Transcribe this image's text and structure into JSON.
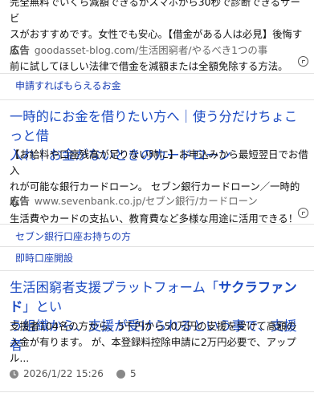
{
  "ad1": {
    "desc_lines": [
      "完全無料でいくら減額できるかスマホから30秒で診断できるサービ",
      "スがおすすめです。女性でも安心。【借金がある人は必見】後悔する",
      "前に試してほしい法律で借金を減額または全額免除する方法。"
    ],
    "ad_label": "広告",
    "url": "goodasset-blog.com/生活困窮者/やるべき1つの事",
    "sitelinks": [
      "申請すればもらえるお金"
    ]
  },
  "ad2": {
    "title_lines": [
      "一時的にお金を借りたい方へ｜使う分だけちょこっと借",
      "入れ｜お金がないときのカードローン"
    ],
    "desc_lines": [
      "【お給料や口座残高が足りない時に】お申込みから最短翌日でお借入",
      "れが可能な銀行カードローン。 セブン銀行カードローン／一時的な",
      "生活費やカードの支払い、教育費など多様な用途に活用できる！"
    ],
    "ad_label": "広告",
    "url": "www.sevenbank.co.jp/セブン銀行/カードローン",
    "sitelinks": [
      "セブン銀行口座お持ちの方",
      "即時口座開設"
    ]
  },
  "article": {
    "title_pre": "生活困窮者支援プラットフォーム「",
    "title_strong": "サクラファンド",
    "title_post": "」とい",
    "title_line2": "う組織から、支援が受けられるという事で、支援者",
    "desc_lines": [
      "支援者104名の方から、5千円から50万円の支援を受けて高額の",
      "入金が有ります。 が、本登録料控除申請に2万円必要で、アップ",
      "ル..."
    ],
    "timestamp": "2026/1/22 15:26",
    "comment_count": "5"
  }
}
